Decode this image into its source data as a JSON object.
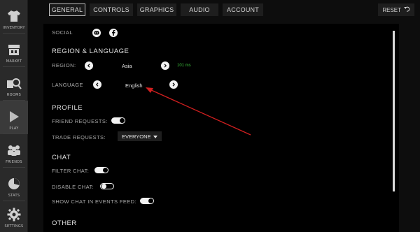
{
  "sidebar": {
    "items": [
      {
        "label": "INVENTORY",
        "icon": "shirt-icon"
      },
      {
        "label": "MARKET",
        "icon": "market-icon"
      },
      {
        "label": "ROOMS",
        "icon": "rooms-icon"
      },
      {
        "label": "PLAY",
        "icon": "play-icon"
      },
      {
        "label": "FRIENDS",
        "icon": "friends-icon"
      },
      {
        "label": "STATS",
        "icon": "stats-icon"
      },
      {
        "label": "SETTINGS",
        "icon": "gear-icon"
      }
    ]
  },
  "tabs": [
    "GENERAL",
    "CONTROLS",
    "GRAPHICS",
    "AUDIO",
    "ACCOUNT"
  ],
  "active_tab": "GENERAL",
  "reset_label": "RESET",
  "social": {
    "label": "SOCIAL",
    "icons": [
      "discord-icon",
      "facebook-icon"
    ]
  },
  "region_language": {
    "heading": "REGION & LANGUAGE",
    "region_label": "REGION:",
    "region_value": "Asia",
    "ping": "101 ms",
    "language_label": "LANGUAGE",
    "language_value": "English"
  },
  "profile": {
    "heading": "PROFILE",
    "friend_requests_label": "FRIEND REQUESTS:",
    "friend_requests_on": true,
    "trade_requests_label": "TRADE REQUESTS:",
    "trade_requests_value": "EVERYONE"
  },
  "chat": {
    "heading": "CHAT",
    "filter_chat_label": "FILTER CHAT:",
    "filter_chat_on": true,
    "disable_chat_label": "DISABLE CHAT:",
    "disable_chat_on": false,
    "show_events_label": "SHOW CHAT IN EVENTS FEED:",
    "show_events_on": true
  },
  "other": {
    "heading": "OTHER"
  },
  "colors": {
    "ping": "#3bbf3b",
    "annotation_arrow": "#d11f1f"
  }
}
